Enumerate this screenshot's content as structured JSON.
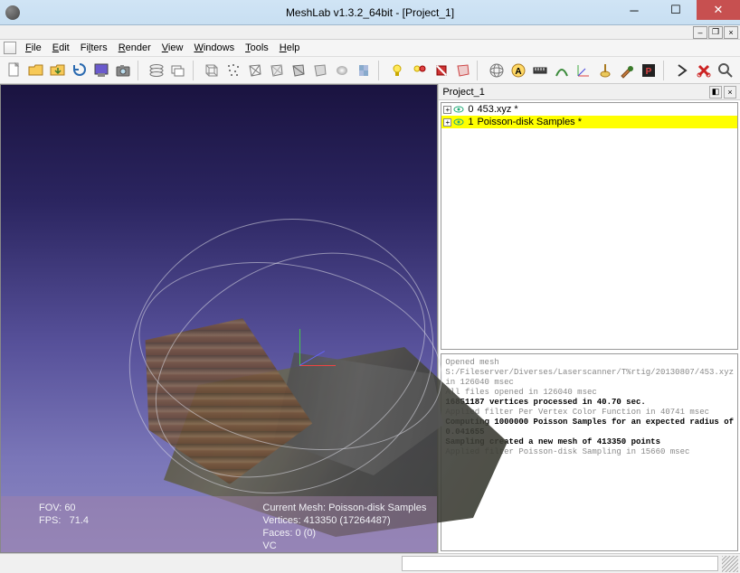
{
  "window": {
    "title": "MeshLab v1.3.2_64bit - [Project_1]"
  },
  "menu": {
    "file": "File",
    "edit": "Edit",
    "filters": "Filters",
    "render": "Render",
    "view": "View",
    "windows": "Windows",
    "tools": "Tools",
    "help": "Help"
  },
  "panel": {
    "title": "Project_1",
    "layers": [
      {
        "index": "0",
        "name": "453.xyz *",
        "selected": false
      },
      {
        "index": "1",
        "name": "Poisson-disk Samples *",
        "selected": true
      }
    ]
  },
  "status": {
    "fov": "FOV: 60",
    "fps": "FPS:   71.4",
    "current_mesh": "Current Mesh: Poisson-disk Samples",
    "vertices": "Vertices: 413350 (17264487)",
    "faces": "Faces: 0 (0)",
    "vc": "VC"
  },
  "log": {
    "l1": "Opened mesh",
    "l2": "S:/Fileserver/Diverses/Laserscanner/T%rtig/20130807/453.xyz in 126040 msec",
    "l3": "All files opened in 126040 msec",
    "l4": "16851187 vertices processed in 40.70 sec.",
    "l5": "Applied filter Per Vertex Color Function in 40741 msec",
    "l6": "Computing 1000000 Poisson Samples for an expected radius of 0.041655",
    "l7": "Sampling created a new mesh of 413350 points",
    "l8": "Applied filter Poisson-disk Sampling in 15660 msec"
  }
}
